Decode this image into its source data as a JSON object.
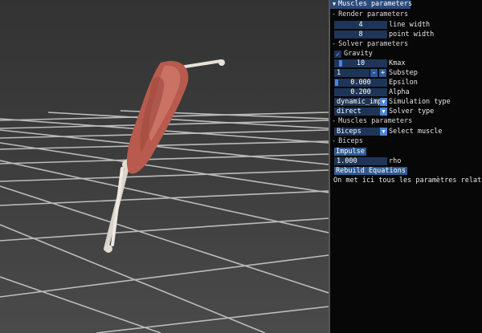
{
  "panel": {
    "title": "Muscles parameters",
    "render": {
      "header": "Render parameters",
      "line_width_value": "4",
      "line_width_label": "line width",
      "point_width_value": "8",
      "point_width_label": "point width"
    },
    "solver": {
      "header": "Solver parameters",
      "gravity_label": "Gravity",
      "gravity_checked": true,
      "kmax_value": "10",
      "kmax_label": "Kmax",
      "substep_value": "1",
      "substep_minus": "-",
      "substep_plus": "+",
      "substep_label": "Substep",
      "epsilon_value": "0.000",
      "epsilon_label": "Epsilon",
      "alpha_value": "0.200",
      "alpha_label": "Alpha",
      "simulation_type_value": "dynamic_impl",
      "simulation_type_label": "Simulation type",
      "solver_type_value": "direct",
      "solver_type_label": "Solver type"
    },
    "muscles": {
      "header": "Muscles parameters",
      "select_value": "Biceps",
      "select_label": "Select muscle"
    },
    "biceps": {
      "header": "Biceps",
      "impulse_button": "Impulse",
      "rho_value": "1.000",
      "rho_label": "rho",
      "rebuild_button": "Rebuild Equations",
      "description": "On met ici tous les paramètres relatif a"
    }
  },
  "icons": {
    "collapse": "triangle-down-icon",
    "checkmark": "check-icon",
    "combo": "triangle-down-icon"
  },
  "colors": {
    "panel_bg": "#070707",
    "field_bg": "#1e3557",
    "button_bg": "#2e5a94",
    "accent": "#4a86d9",
    "muscle": "#b85a4e"
  }
}
